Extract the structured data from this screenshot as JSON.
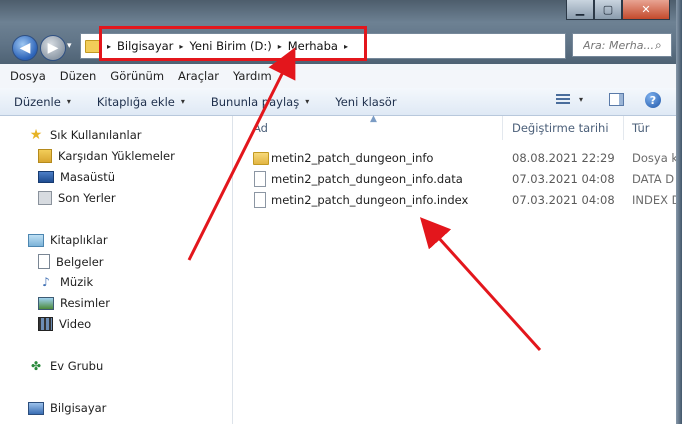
{
  "window": {
    "minimize_symbol": "▁",
    "maximize_symbol": "▢",
    "close_symbol": "✕"
  },
  "address_bar": {
    "breadcrumbs": [
      "Bilgisayar",
      "Yeni Birim (D:)",
      "Merhaba"
    ],
    "separator": "▸",
    "dropdown": "▾",
    "refresh": "⟳"
  },
  "search": {
    "placeholder": "Ara: Merha...",
    "icon": "search-icon"
  },
  "menu": [
    "Dosya",
    "Düzen",
    "Görünüm",
    "Araçlar",
    "Yardım"
  ],
  "toolbar": {
    "organize": "Düzenle",
    "add_to_library": "Kitaplığa ekle",
    "share_with": "Bununla paylaş",
    "new_folder": "Yeni klasör",
    "dropdown": "▾",
    "help": "?"
  },
  "nav": {
    "favorites": "Sık Kullanılanlar",
    "downloads": "Karşıdan Yüklemeler",
    "desktop": "Masaüstü",
    "recent": "Son Yerler",
    "libraries": "Kitaplıklar",
    "documents": "Belgeler",
    "music": "Müzik",
    "pictures": "Resimler",
    "videos": "Video",
    "homegroup": "Ev Grubu",
    "computer": "Bilgisayar"
  },
  "columns": {
    "name": "Ad",
    "date": "Değiştirme tarihi",
    "type": "Tür",
    "sort_indicator": "▲"
  },
  "files": [
    {
      "name": "metin2_patch_dungeon_info",
      "date": "08.08.2021 22:29",
      "type": "Dosya kl",
      "icon": "folder-icon"
    },
    {
      "name": "metin2_patch_dungeon_info.data",
      "date": "07.03.2021 04:08",
      "type": "DATA D",
      "icon": "file-icon"
    },
    {
      "name": "metin2_patch_dungeon_info.index",
      "date": "07.03.2021 04:08",
      "type": "INDEX D",
      "icon": "file-icon"
    }
  ],
  "annotation_color": "#e3161c"
}
